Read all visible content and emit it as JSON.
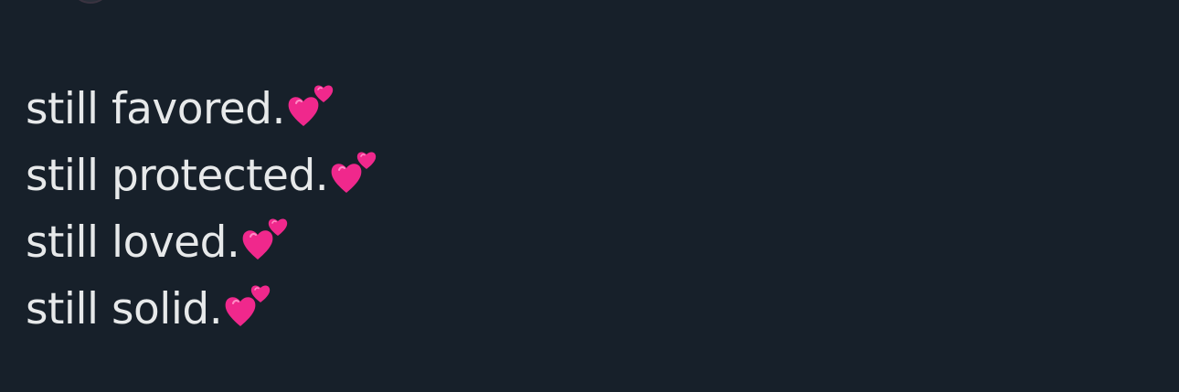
{
  "tweet": {
    "lines": [
      {
        "text": "still favored.",
        "emoji": "two-hearts-icon"
      },
      {
        "text": "still protected.",
        "emoji": "two-hearts-icon"
      },
      {
        "text": "still loved.",
        "emoji": "two-hearts-icon"
      },
      {
        "text": "still solid.",
        "emoji": "two-hearts-icon"
      }
    ]
  },
  "colors": {
    "background": "#17202a",
    "text": "#e7e9ea",
    "heart": "#f0288c"
  }
}
